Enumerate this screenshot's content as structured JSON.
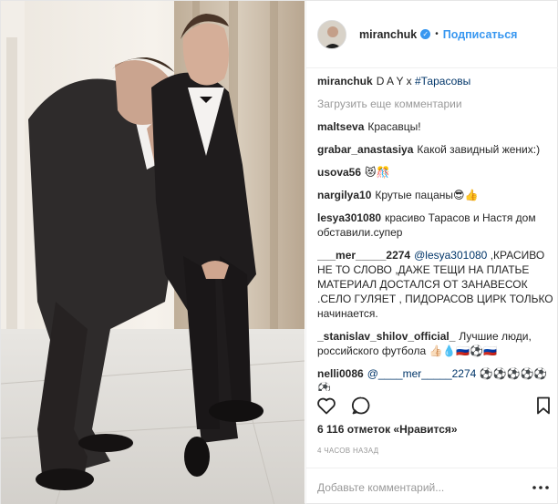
{
  "post": {
    "username": "miranchuk",
    "verified_glyph": "✓",
    "separator": "•",
    "follow_label": "Подписаться"
  },
  "caption": {
    "user": "miranchuk",
    "text": "D A Y x",
    "hashtag": "#Тарасовы"
  },
  "load_more_label": "Загрузить еще комментарии",
  "comments": [
    {
      "user": "maltseva",
      "text": "Красавцы!"
    },
    {
      "user": "grabar_anastasiya",
      "text": "Какой завидный жених:)"
    },
    {
      "user": "usova56",
      "text": "😻🎊"
    },
    {
      "user": "nargilya10",
      "text": "Крутые пацаны😎👍"
    },
    {
      "user": "lesya301080",
      "text": "красиво Тарасов и Настя дом обставили.супер"
    },
    {
      "user": "___mer_____2274",
      "mention": "@lesya301080",
      "text": ",КРАСИВО НЕ ТО СЛОВО ,ДАЖЕ ТЕЩИ НА ПЛАТЬЕ МАТЕРИАЛ ДОСТАЛСЯ ОТ ЗАНАВЕСОК .СЕЛО ГУЛЯЕТ , ПИДОРАСОВ ЦИРК ТОЛЬКО начинается."
    },
    {
      "user": "_stanislav_shilov_official_",
      "text": "Лучшие люди, российского футбола 👍🏻💧🇷🇺⚽🇷🇺"
    },
    {
      "user": "nelli0086",
      "mention": "@____mer_____2274",
      "text": "⚽⚽⚽⚽⚽⚽"
    }
  ],
  "likes": {
    "count": "6 116",
    "text": "отметок «Нравится»"
  },
  "time_ago": "4 часов назад",
  "add_comment": {
    "placeholder": "Добавьте комментарий..."
  },
  "icons": {
    "like": "heart-icon",
    "comment": "comment-icon",
    "save": "bookmark-icon",
    "more": "more-options-icon",
    "verified": "verified-badge-icon"
  },
  "colors": {
    "accent": "#3897f0",
    "link": "#003569",
    "muted": "#999999",
    "text": "#262626",
    "border": "#efefef"
  }
}
